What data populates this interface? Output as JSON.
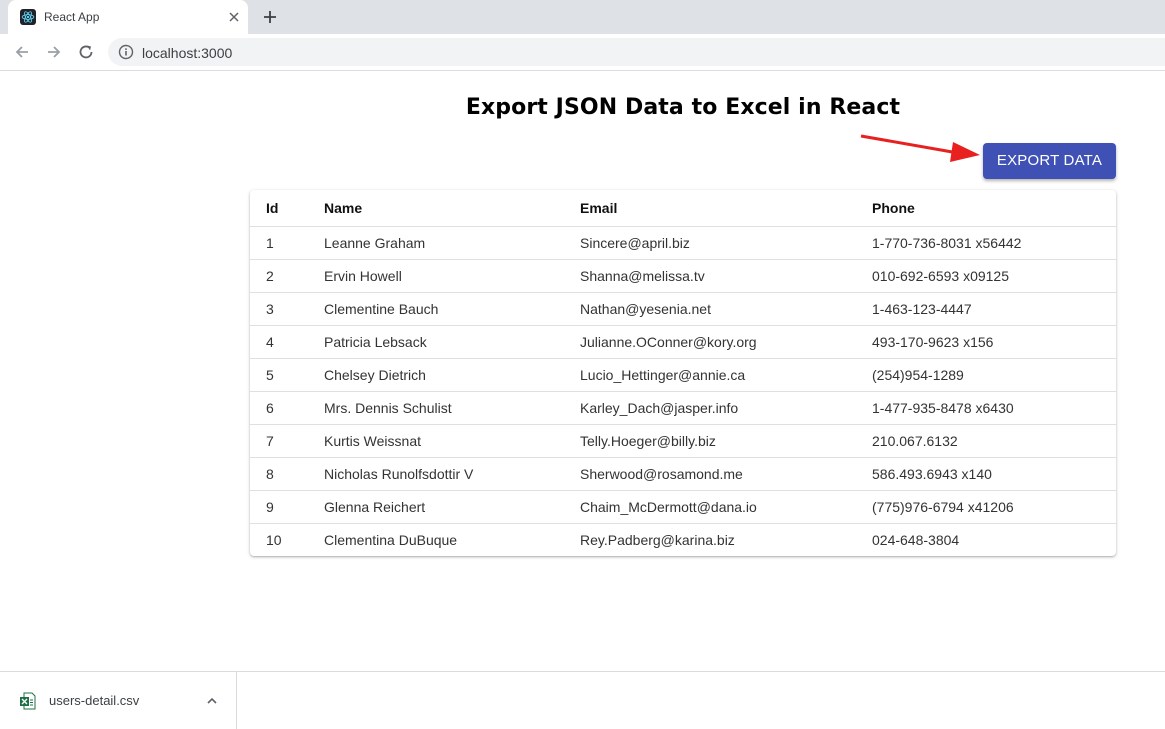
{
  "browser": {
    "tab_title": "React App",
    "url": "localhost:3000"
  },
  "page": {
    "title": "Export JSON Data to Excel in React",
    "export_label": "EXPORT DATA"
  },
  "table": {
    "headers": {
      "id": "Id",
      "name": "Name",
      "email": "Email",
      "phone": "Phone"
    },
    "rows": [
      {
        "id": "1",
        "name": "Leanne Graham",
        "email": "Sincere@april.biz",
        "phone": "1-770-736-8031 x56442"
      },
      {
        "id": "2",
        "name": "Ervin Howell",
        "email": "Shanna@melissa.tv",
        "phone": "010-692-6593 x09125"
      },
      {
        "id": "3",
        "name": "Clementine Bauch",
        "email": "Nathan@yesenia.net",
        "phone": "1-463-123-4447"
      },
      {
        "id": "4",
        "name": "Patricia Lebsack",
        "email": "Julianne.OConner@kory.org",
        "phone": "493-170-9623 x156"
      },
      {
        "id": "5",
        "name": "Chelsey Dietrich",
        "email": "Lucio_Hettinger@annie.ca",
        "phone": "(254)954-1289"
      },
      {
        "id": "6",
        "name": "Mrs. Dennis Schulist",
        "email": "Karley_Dach@jasper.info",
        "phone": "1-477-935-8478 x6430"
      },
      {
        "id": "7",
        "name": "Kurtis Weissnat",
        "email": "Telly.Hoeger@billy.biz",
        "phone": "210.067.6132"
      },
      {
        "id": "8",
        "name": "Nicholas Runolfsdottir V",
        "email": "Sherwood@rosamond.me",
        "phone": "586.493.6943 x140"
      },
      {
        "id": "9",
        "name": "Glenna Reichert",
        "email": "Chaim_McDermott@dana.io",
        "phone": "(775)976-6794 x41206"
      },
      {
        "id": "10",
        "name": "Clementina DuBuque",
        "email": "Rey.Padberg@karina.biz",
        "phone": "024-648-3804"
      }
    ]
  },
  "downloads": {
    "file_name": "users-detail.csv"
  },
  "colors": {
    "button": "#3f51b5",
    "arrow": "#e8201f",
    "excel_icon": "#1d7044"
  },
  "icons": {
    "tab_favicon": "react-icon",
    "tab_close": "close-icon",
    "new_tab": "plus-icon",
    "back": "arrow-left-icon",
    "forward": "arrow-right-icon",
    "reload": "reload-icon",
    "site_info": "info-icon",
    "download_file": "excel-file-icon",
    "download_menu": "chevron-up-icon"
  }
}
